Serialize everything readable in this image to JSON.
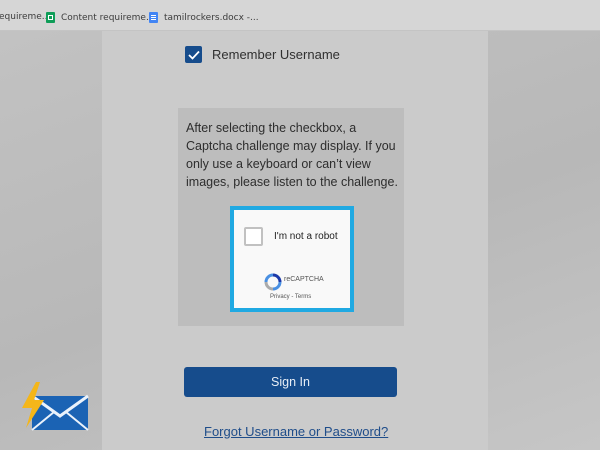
{
  "bookmarks": {
    "items": [
      {
        "label": "equireme..."
      },
      {
        "label": "Content requireme...",
        "icon": "sheets-icon"
      },
      {
        "label": "tamilrockers.docx -...",
        "icon": "docs-icon"
      }
    ]
  },
  "login": {
    "remember_label": "Remember Username",
    "remember_checked": true,
    "info_text": "After selecting the checkbox, a Captcha challenge may display. If you only use a keyboard or can’t view images, please listen to the challenge.",
    "captcha": {
      "label": "I'm not a robot",
      "brand": "reCAPTCHA",
      "links": "Privacy - Terms",
      "highlight_color": "#20A9E2"
    },
    "signin_label": "Sign In",
    "forgot_label": "Forgot Username or Password?"
  },
  "colors": {
    "primary": "#164C8C",
    "link": "#1F4D8A"
  },
  "overlay": {
    "logo_icon": "envelope-lightning-logo"
  }
}
